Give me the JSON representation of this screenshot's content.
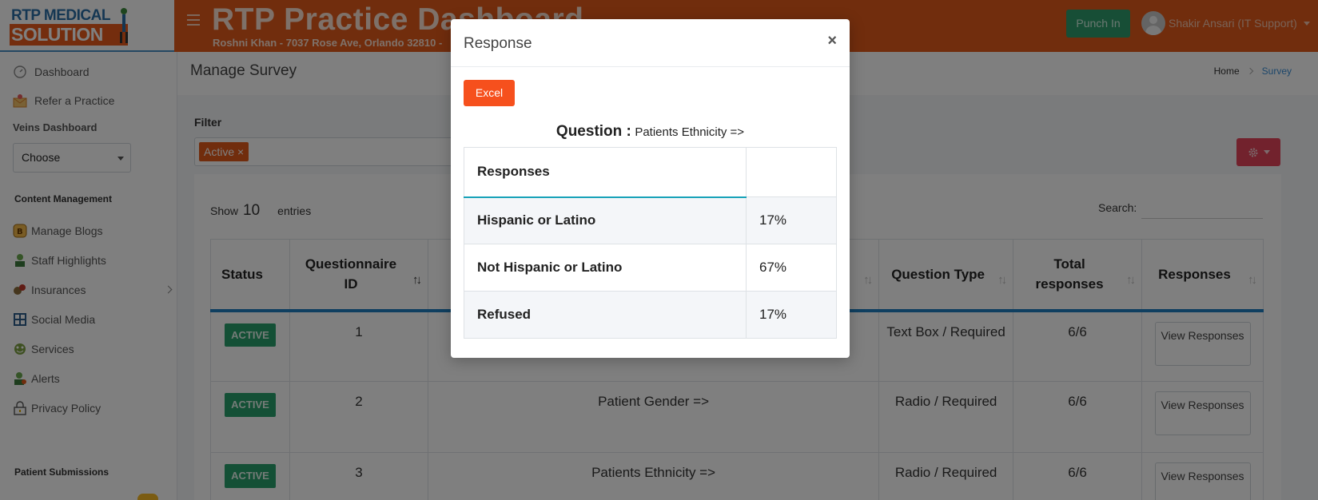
{
  "brand": {
    "logo_top": "RTP MEDICAL",
    "logo_bottom": "SOLUTION"
  },
  "header": {
    "title": "RTP Practice Dashboard",
    "subtitle": "Roshni Khan - 7037 Rose Ave, Orlando 32810 -",
    "punch_label": "Punch In",
    "user_name": "Shakir Ansari (IT Support)"
  },
  "sidebar": {
    "dashboard": "Dashboard",
    "refer": "Refer a Practice",
    "veins_label": "Veins Dashboard",
    "veins_select": "Choose",
    "content_head": "Content Management",
    "items": [
      "Manage Blogs",
      "Staff Highlights",
      "Insurances",
      "Social Media",
      "Services",
      "Alerts",
      "Privacy Policy"
    ],
    "patient_head": "Patient Submissions"
  },
  "page": {
    "title": "Manage Survey",
    "breadcrumb_home": "Home",
    "breadcrumb_current": "Survey",
    "filter_label": "Filter",
    "filter_tag": "Active ×",
    "show_label": "Show",
    "show_value": "10",
    "entries_label": "entries",
    "search_label": "Search:"
  },
  "table": {
    "headers": [
      "Status",
      "Questionnaire ID",
      "",
      "Question Type",
      "Total responses",
      "Responses"
    ],
    "rows": [
      {
        "status": "ACTIVE",
        "id": "1",
        "question": "",
        "type": "Text Box / Required",
        "total": "6/6",
        "action": "View Responses"
      },
      {
        "status": "ACTIVE",
        "id": "2",
        "question": "Patient Gender =>",
        "type": "Radio / Required",
        "total": "6/6",
        "action": "View Responses"
      },
      {
        "status": "ACTIVE",
        "id": "3",
        "question": "Patients Ethnicity =>",
        "type": "Radio / Required",
        "total": "6/6",
        "action": "View Responses"
      }
    ]
  },
  "modal": {
    "title": "Response",
    "close": "×",
    "excel": "Excel",
    "question_label": "Question :",
    "question_text": "Patients Ethnicity =>",
    "responses_header": "Responses",
    "responses": [
      {
        "label": "Hispanic or Latino",
        "pct": "17%"
      },
      {
        "label": "Not Hispanic or Latino",
        "pct": "67%"
      },
      {
        "label": "Refused",
        "pct": "17%"
      }
    ]
  },
  "colors": {
    "header_bg": "#e35b1b",
    "active_badge": "#28a06c",
    "excel_btn": "#f6501d",
    "table_accent": "#1e7fc1"
  }
}
